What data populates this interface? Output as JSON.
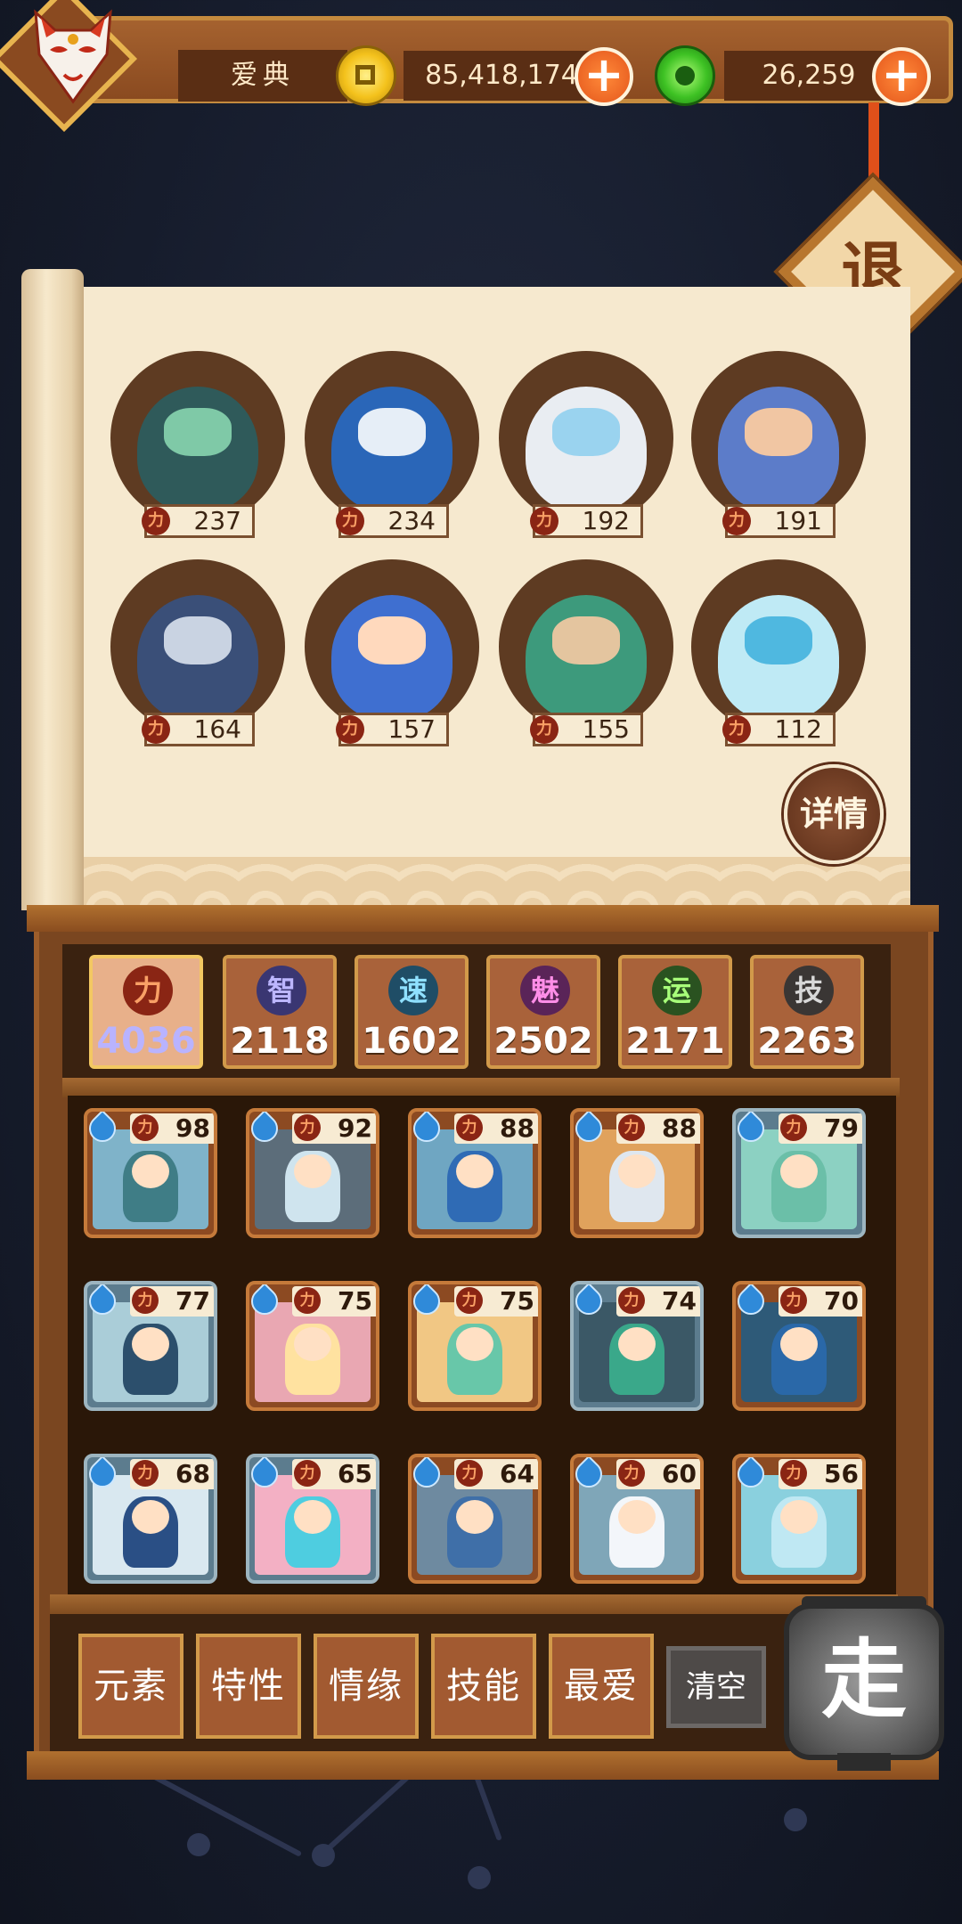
{
  "player": {
    "name": "爱典"
  },
  "currency": {
    "gold": "85,418,174",
    "jade": "26,259",
    "plus": "+"
  },
  "exit_label": "退",
  "detail_label": "详情",
  "power_icon": "力",
  "top_heroes": [
    {
      "power": "237",
      "color": "#2f5a5a",
      "face": "#7fc9a7"
    },
    {
      "power": "234",
      "color": "#2a66b8",
      "face": "#e6eef7"
    },
    {
      "power": "192",
      "color": "#e9edf2",
      "face": "#9ad3ef"
    },
    {
      "power": "191",
      "color": "#5c7cc9",
      "face": "#f1c6a3"
    },
    {
      "power": "164",
      "color": "#3a4f78",
      "face": "#c9d3e2"
    },
    {
      "power": "157",
      "color": "#3f6fd0",
      "face": "#ffd9bd"
    },
    {
      "power": "155",
      "color": "#3d9a7c",
      "face": "#e4c59f"
    },
    {
      "power": "112",
      "color": "#bfeaf5",
      "face": "#4fb8e0"
    }
  ],
  "stats": [
    {
      "symbol": "力",
      "value": "4036",
      "bg": "#8a2514",
      "fg": "#f9a066",
      "active": true
    },
    {
      "symbol": "智",
      "value": "2118",
      "bg": "#3a3672",
      "fg": "#bcb6ff",
      "active": false
    },
    {
      "symbol": "速",
      "value": "1602",
      "bg": "#1f4d66",
      "fg": "#8fe0ff",
      "active": false
    },
    {
      "symbol": "魅",
      "value": "2502",
      "bg": "#5a2458",
      "fg": "#ff8ee8",
      "active": false
    },
    {
      "symbol": "运",
      "value": "2171",
      "bg": "#2a5220",
      "fg": "#a8ff7a",
      "active": false
    },
    {
      "symbol": "技",
      "value": "2263",
      "bg": "#3a3634",
      "fg": "#d8d8d8",
      "active": false
    }
  ],
  "cards": [
    {
      "power": "98",
      "frame": "brown",
      "scene": "#7fb3c9",
      "char": "#3f7d86"
    },
    {
      "power": "92",
      "frame": "brown",
      "scene": "#5c6d7a",
      "char": "#cfe4ee"
    },
    {
      "power": "88",
      "frame": "brown",
      "scene": "#6fa6c2",
      "char": "#2f6bb5"
    },
    {
      "power": "88",
      "frame": "brown",
      "scene": "#e0a25c",
      "char": "#dfe7ef"
    },
    {
      "power": "79",
      "frame": "blue",
      "scene": "#8cd1c2",
      "char": "#6bbfa8"
    },
    {
      "power": "77",
      "frame": "blue",
      "scene": "#aacdd8",
      "char": "#2c4f6c"
    },
    {
      "power": "75",
      "frame": "brown",
      "scene": "#e9a7b2",
      "char": "#ffe2a0"
    },
    {
      "power": "75",
      "frame": "brown",
      "scene": "#f1c784",
      "char": "#68c7a9"
    },
    {
      "power": "74",
      "frame": "blue",
      "scene": "#3b5866",
      "char": "#3aa88a"
    },
    {
      "power": "70",
      "frame": "brown",
      "scene": "#2e5a78",
      "char": "#2a68a8"
    },
    {
      "power": "68",
      "frame": "blue",
      "scene": "#d9e8f0",
      "char": "#2a4f85"
    },
    {
      "power": "65",
      "frame": "blue",
      "scene": "#f3b0c4",
      "char": "#4ecde0"
    },
    {
      "power": "64",
      "frame": "brown",
      "scene": "#6e8aa0",
      "char": "#3f6fa8"
    },
    {
      "power": "60",
      "frame": "brown",
      "scene": "#7fa6b8",
      "char": "#f3f6fa"
    },
    {
      "power": "56",
      "frame": "brown",
      "scene": "#8ad0de",
      "char": "#bfe8f3"
    }
  ],
  "filters": [
    "元素",
    "特性",
    "情缘",
    "技能",
    "最爱"
  ],
  "clear_label": "清空",
  "go_label": "走"
}
